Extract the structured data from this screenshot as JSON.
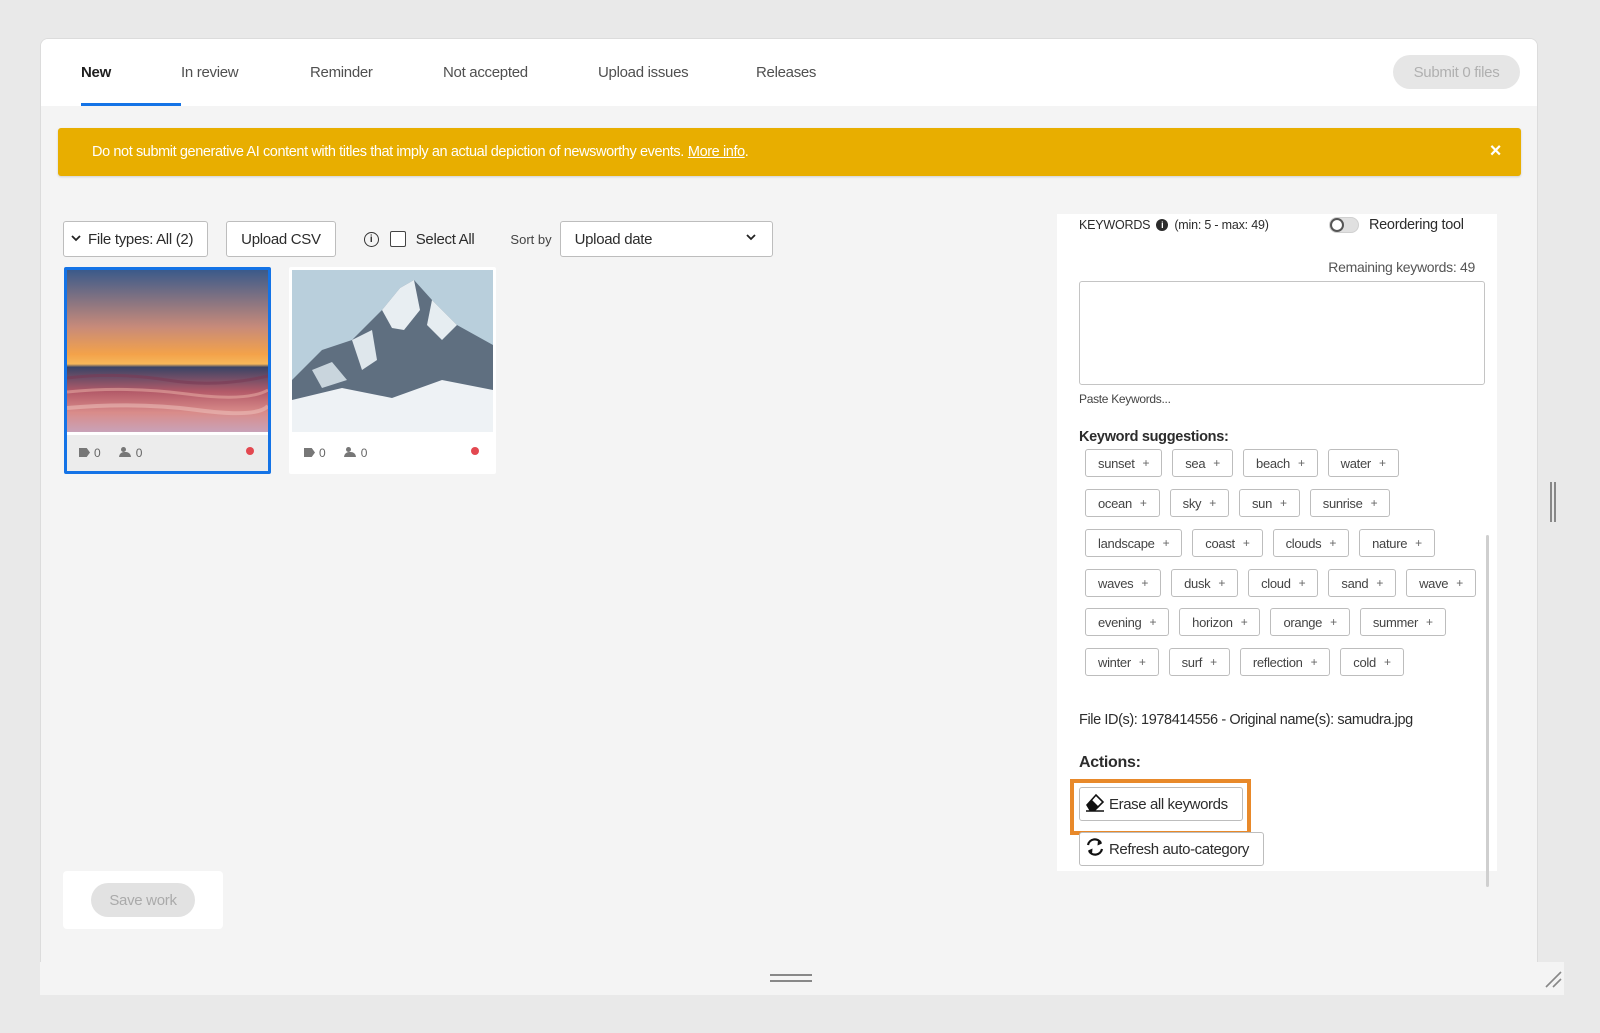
{
  "tabs": [
    {
      "label": "New",
      "active": true
    },
    {
      "label": "In review"
    },
    {
      "label": "Reminder"
    },
    {
      "label": "Not accepted"
    },
    {
      "label": "Upload issues"
    },
    {
      "label": "Releases"
    }
  ],
  "submit_label": "Submit 0 files",
  "banner": {
    "text": "Do not submit generative AI content with titles that imply an actual depiction of newsworthy events.",
    "link": "More info",
    "link_suffix": ".",
    "close": "×",
    "color": "#e8ae00"
  },
  "toolbar": {
    "file_types": "File types: All (2)",
    "upload_csv": "Upload CSV",
    "info_glyph": "i",
    "select_all": "Select All",
    "sort_by": "Sort by",
    "sort_value": "Upload date"
  },
  "thumbnails": [
    {
      "keywords": "0",
      "people": "0",
      "selected": true
    },
    {
      "keywords": "0",
      "people": "0",
      "selected": false
    }
  ],
  "save_label": "Save work",
  "panel": {
    "keywords_label": "KEYWORDS",
    "keywords_range": "(min: 5 - max: 49)",
    "reorder_label": "Reordering tool",
    "remaining": "Remaining keywords: 49",
    "paste": "Paste Keywords...",
    "suggestions_title": "Keyword suggestions:",
    "suggestion_rows": [
      [
        "sunset",
        "sea",
        "beach",
        "water"
      ],
      [
        "ocean",
        "sky",
        "sun",
        "sunrise"
      ],
      [
        "landscape",
        "coast",
        "clouds",
        "nature"
      ],
      [
        "waves",
        "dusk",
        "cloud",
        "sand",
        "wave"
      ],
      [
        "evening",
        "horizon",
        "orange",
        "summer"
      ],
      [
        "winter",
        "surf",
        "reflection",
        "cold"
      ]
    ],
    "file_info": "File ID(s): 1978414556 - Original name(s): samudra.jpg",
    "actions_title": "Actions:",
    "erase_label": "Erase all keywords",
    "refresh_label": "Refresh auto-category"
  },
  "colors": {
    "accent": "#1473e6",
    "highlight": "#e8892a",
    "status_dot": "#e34850"
  }
}
